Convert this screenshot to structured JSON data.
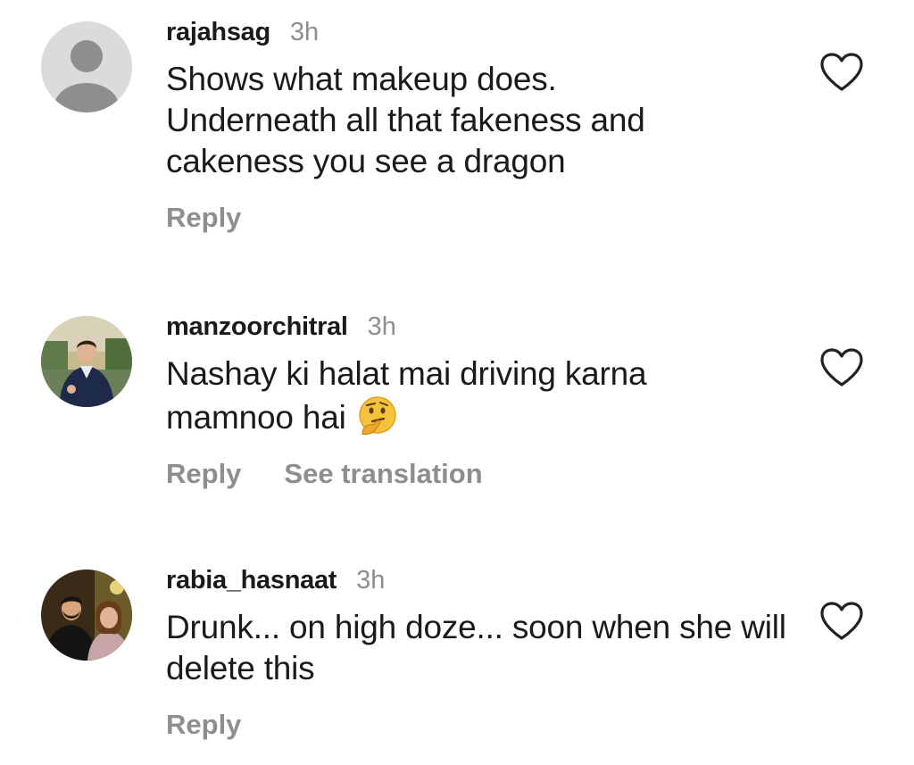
{
  "comments": [
    {
      "username": "rajahsag",
      "time": "3h",
      "text": "Shows what makeup does. Underneath all that fakeness and cakeness you see a dragon",
      "actions": [
        "Reply"
      ]
    },
    {
      "username": "manzoorchitral",
      "time": "3h",
      "text": "Nashay ki halat mai driving karna mamnoo hai",
      "emoji": "thinking-face",
      "actions": [
        "Reply",
        "See translation"
      ]
    },
    {
      "username": "rabia_hasnaat",
      "time": "3h",
      "text": "Drunk... on high doze... soon when she will delete this",
      "actions": [
        "Reply"
      ]
    }
  ],
  "icons": {
    "like": "heart-outline-icon",
    "emoji": "thinking-face"
  },
  "colors": {
    "muted": "#8e8e8e",
    "text": "#1a1a1a",
    "avatar_placeholder": "#dbdbdb"
  }
}
